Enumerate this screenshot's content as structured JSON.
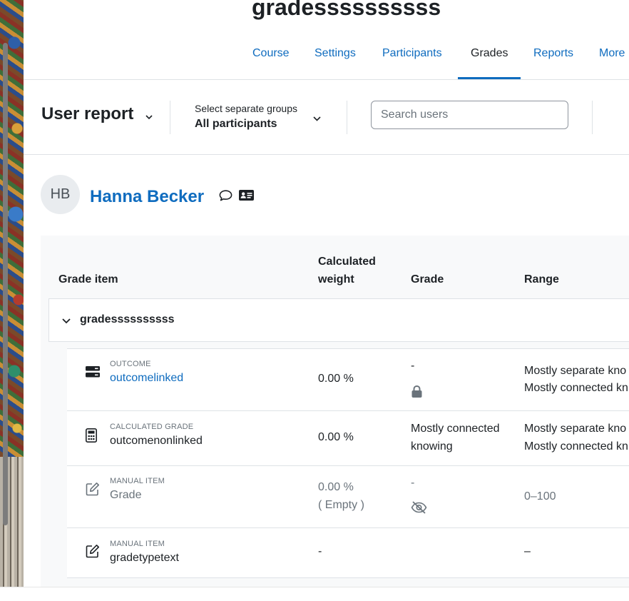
{
  "course": {
    "title": "gradessssssssss"
  },
  "nav": {
    "tabs": [
      {
        "label": "Course"
      },
      {
        "label": "Settings"
      },
      {
        "label": "Participants"
      },
      {
        "label": "Grades"
      },
      {
        "label": "Reports"
      },
      {
        "label": "More"
      }
    ],
    "active_tab": "Grades"
  },
  "tertiary": {
    "report_selector": "User report",
    "group_label": "Select separate groups",
    "group_value": "All participants",
    "search_placeholder": "Search users"
  },
  "user": {
    "initials": "HB",
    "name": "Hanna Becker",
    "icons": [
      "message-icon",
      "profile-card-icon"
    ]
  },
  "table": {
    "headers": {
      "grade_item": "Grade item",
      "weight_line1": "Calculated",
      "weight_line2": "weight",
      "grade": "Grade",
      "range": "Range"
    },
    "category": {
      "name": "gradessssssssss",
      "icon": "chevron-down-icon"
    },
    "rows": [
      {
        "type": "OUTCOME",
        "name": "outcomelinked",
        "icon": "outcome-icon",
        "weight": "0.00 %",
        "grade": "-",
        "grade_icon": "lock-icon",
        "range_line1": "Mostly separate kno",
        "range_line2": "Mostly connected kn"
      },
      {
        "type": "CALCULATED GRADE",
        "name": "outcomenonlinked",
        "icon": "calculator-icon",
        "weight": "0.00 %",
        "grade_line1": "Mostly connected",
        "grade_line2": "knowing",
        "range_line1": "Mostly separate kno",
        "range_line2": "Mostly connected kn"
      },
      {
        "type": "MANUAL ITEM",
        "name": "Grade",
        "icon": "edit-icon",
        "weight": "0.00 %",
        "weight_note": "( Empty )",
        "grade": "-",
        "grade_icon": "eye-slash-icon",
        "range": "0–100"
      },
      {
        "type": "MANUAL ITEM",
        "name": "gradetypetext",
        "icon": "edit-icon",
        "weight": "-",
        "range": "–"
      }
    ]
  },
  "colors": {
    "link": "#0f6cbf",
    "text": "#1d2125",
    "muted": "#6a737b",
    "panel": "#f8f9fa"
  }
}
